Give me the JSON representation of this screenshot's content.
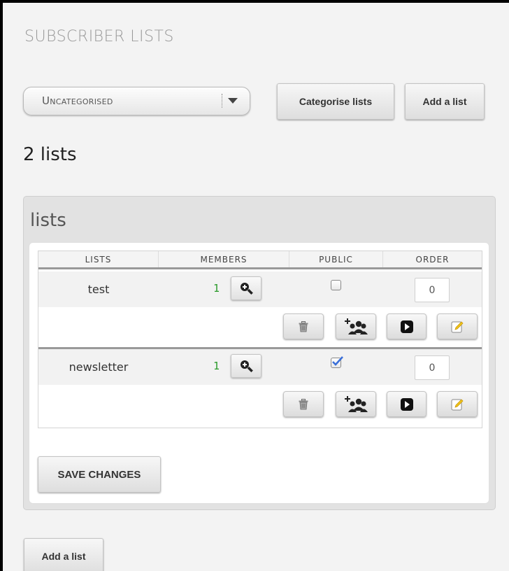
{
  "header": {
    "title": "SUBSCRIBER LISTS"
  },
  "category_select": {
    "value": "Uncategorised"
  },
  "toolbar": {
    "categorise_label": "Categorise lists",
    "add_list_label": "Add a list"
  },
  "summary": {
    "count_label": "2 lists"
  },
  "panel": {
    "title": "lists",
    "columns": [
      "LISTS",
      "MEMBERS",
      "PUBLIC",
      "ORDER"
    ],
    "rows": [
      {
        "name": "test",
        "members": "1",
        "public": false,
        "order": "0"
      },
      {
        "name": "newsletter",
        "members": "1",
        "public": true,
        "order": "0"
      }
    ],
    "save_label": "SAVE CHANGES"
  },
  "footer": {
    "add_list_label": "Add a list"
  },
  "icons": {
    "zoom": "zoom-in-icon",
    "delete": "trash-icon",
    "subscribers": "add-users-icon",
    "view": "play-icon",
    "edit": "edit-icon"
  },
  "colors": {
    "member_count": "#2a9a2a",
    "checkbox_check": "#3a6fd8",
    "edit_icon": "#f0c419"
  }
}
